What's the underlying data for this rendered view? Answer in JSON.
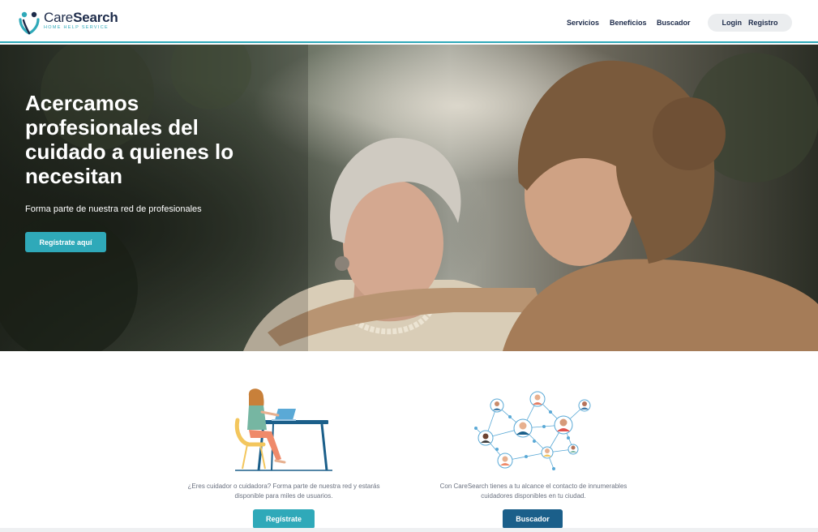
{
  "brand": {
    "name_part1": "Care",
    "name_part2": "Search",
    "tagline": "HOME HELP SERVICE",
    "accent_color": "#2fa9b9",
    "navy_color": "#1d2b4a"
  },
  "nav": {
    "items": [
      "Servicios",
      "Beneficios",
      "Buscador"
    ],
    "login": "Login",
    "register": "Registro"
  },
  "hero": {
    "title": "Acercamos profesionales del cuidado a quienes lo necesitan",
    "subtitle": "Forma parte de nuestra red de profesionales",
    "cta": "Regístrate aquí"
  },
  "cards": [
    {
      "text": "¿Eres cuidador o cuidadora? Forma parte de nuestra red y estarás disponible para miles de usuarios.",
      "button": "Regístrate",
      "illustration": "woman-laptop-illustration"
    },
    {
      "text": "Con CareSearch tienes a tu alcance el contacto de innumerables cuidadores disponibles en tu ciudad.",
      "button": "Buscador",
      "illustration": "network-people-illustration"
    }
  ]
}
